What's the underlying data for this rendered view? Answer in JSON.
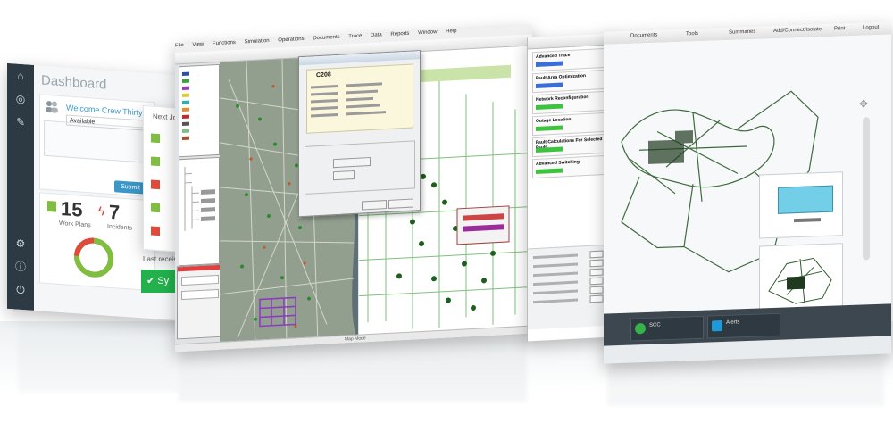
{
  "dashboard": {
    "title": "Dashboard",
    "welcome": "Welcome Crew Thirty Two",
    "status_value": "Available",
    "submit_label": "Submit",
    "work_plans_count": "15",
    "work_plans_label": "Work Plans",
    "incidents_count": "7",
    "incidents_label": "Incidents",
    "next_jobs_label": "Next Jobs",
    "last_received_label": "Last received",
    "button_label": "Sy"
  },
  "gis_window": {
    "menu": [
      "File",
      "View",
      "Functions",
      "Simulation",
      "Operations",
      "Documents",
      "Trace",
      "Data",
      "Reports",
      "Window",
      "Help"
    ],
    "dialog_code": "C208",
    "statusbar_text": "Map Mode"
  },
  "task_panel": {
    "steps": [
      "Advanced Trace",
      "Fault Area Optimization",
      "Network Reconfiguration",
      "Outage Location",
      "Fault Calculations For Selected Fault",
      "Advanced Switching"
    ]
  },
  "web_client": {
    "tabs": [
      "Documents",
      "Tools",
      "Summaries",
      "Add/Connect/Isolate",
      "Print",
      "Logout"
    ],
    "tiles": [
      {
        "label": "SCC",
        "color": "#36b24a"
      },
      {
        "label": "Alerts",
        "color": "#1e9bd7"
      }
    ]
  },
  "colors": {
    "accent_blue": "#3b98c9",
    "accent_green": "#22b14c",
    "status_green": "#3ec33e",
    "dark_rail": "#2d3a44"
  }
}
